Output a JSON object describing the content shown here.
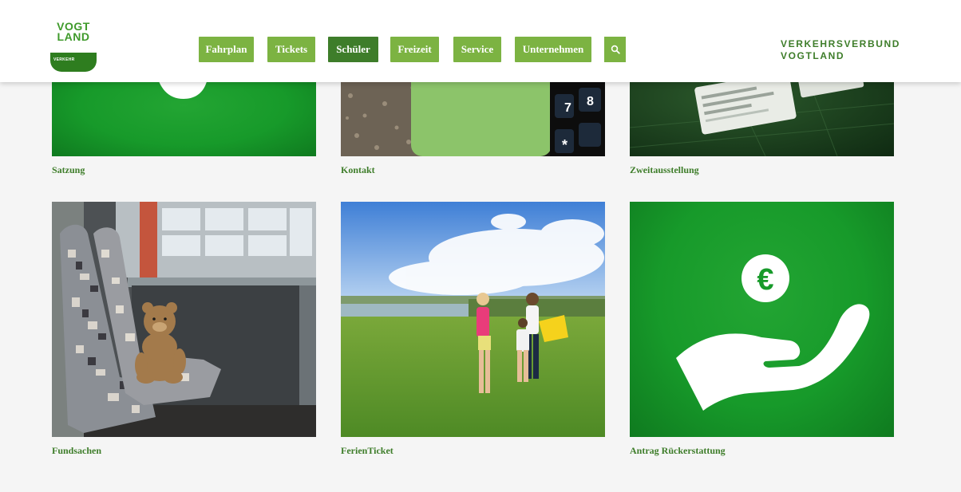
{
  "header": {
    "logo": {
      "line1": "VOGT",
      "line2": "LAND",
      "badge": "VERKEHR"
    },
    "nav": [
      {
        "label": "Fahrplan",
        "active": false
      },
      {
        "label": "Tickets",
        "active": false
      },
      {
        "label": "Schüler",
        "active": true
      },
      {
        "label": "Freizeit",
        "active": false
      },
      {
        "label": "Service",
        "active": false
      },
      {
        "label": "Unternehmen",
        "active": false
      }
    ],
    "search_icon": "search-icon",
    "brand": {
      "line1": "VERKEHRSVERBUND",
      "line2": "VOGTLAND"
    }
  },
  "tiles": [
    {
      "caption": "Satzung"
    },
    {
      "caption": "Kontakt"
    },
    {
      "caption": "Zweitausstellung"
    },
    {
      "caption": "Fundsachen"
    },
    {
      "caption": "FerienTicket"
    },
    {
      "caption": "Antrag Rückerstattung",
      "symbol": "€"
    }
  ],
  "colors": {
    "accent": "#7cb342",
    "accent_dark": "#3e7d2a",
    "tile_green": "#179a2a"
  }
}
